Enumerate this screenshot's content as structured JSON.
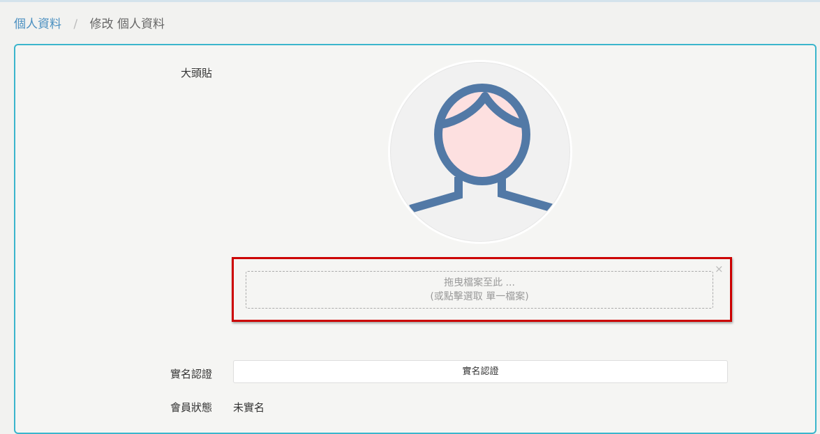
{
  "breadcrumb": {
    "parent": "個人資料",
    "separator": "/",
    "current": "修改 個人資料"
  },
  "form": {
    "avatar_label": "大頭貼",
    "avatar_icon": "default-user-avatar-icon",
    "dropzone": {
      "line1": "拖曳檔案至此 ...",
      "line2": "(或點擊選取 單一檔案)",
      "close_symbol": "×"
    },
    "verification_label": "實名認證",
    "verification_button": "實名認證",
    "status_label": "會員狀態",
    "status_value": "未實名"
  },
  "colors": {
    "breadcrumb_link": "#4a8fc0",
    "panel_border": "#3bb5cc",
    "highlight_border": "#cc0000",
    "avatar_outline": "#5279a6",
    "avatar_face": "#fde0e0"
  }
}
